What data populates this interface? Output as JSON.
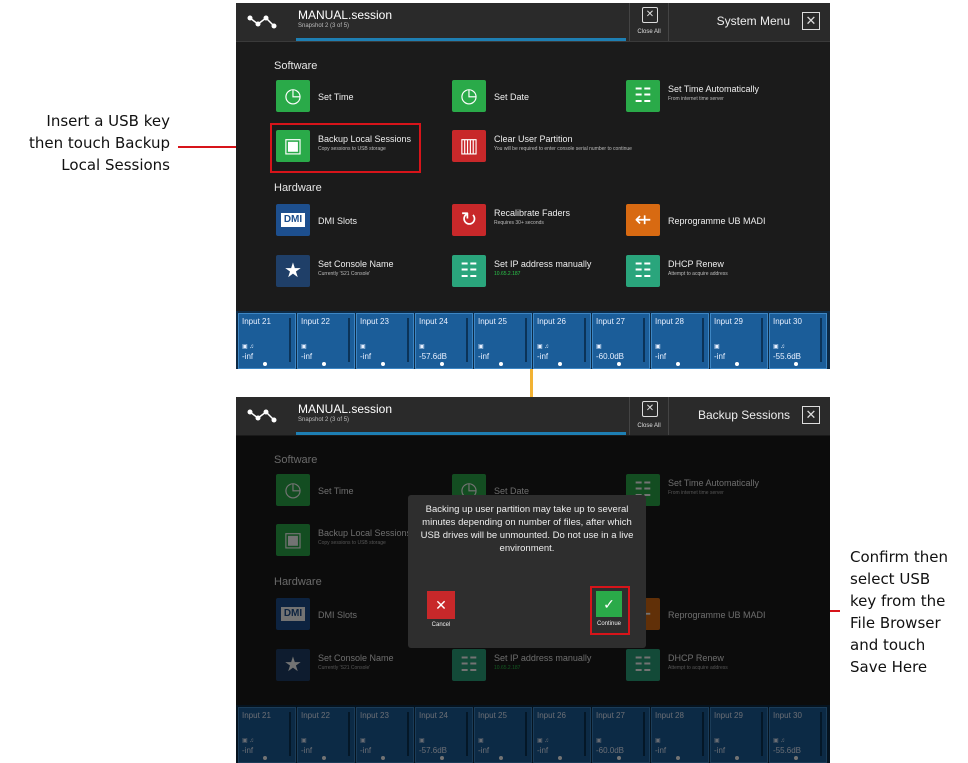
{
  "callout_left": {
    "lines": [
      "Insert a USB key",
      "then touch Backup",
      "Local Sessions"
    ]
  },
  "callout_right": {
    "lines": [
      "Confirm then",
      "select USB",
      "key from the",
      "File Browser",
      "and touch",
      "Save Here"
    ]
  },
  "header": {
    "session": "MANUAL.session",
    "snapshot": "Snapshot 2 (3 of 5)",
    "close_all": "Close All"
  },
  "screen1": {
    "title": "System Menu"
  },
  "screen2": {
    "title": "Backup Sessions"
  },
  "sections": {
    "software": "Software",
    "hardware": "Hardware"
  },
  "items": {
    "set_time": {
      "title": "Set Time"
    },
    "set_date": {
      "title": "Set Date"
    },
    "set_time_auto": {
      "title": "Set Time Automatically",
      "sub": "From internet time server"
    },
    "backup": {
      "title": "Backup Local Sessions",
      "sub": "Copy sessions to USB storage"
    },
    "clear": {
      "title": "Clear User Partition",
      "sub": "You will be required to enter console serial number to continue"
    },
    "dmi": {
      "title": "DMI Slots",
      "icon_text": "DMI"
    },
    "recal": {
      "title": "Recalibrate Faders",
      "sub": "Requires 30+ seconds"
    },
    "reprog": {
      "title": "Reprogramme UB MADI"
    },
    "console_name": {
      "title": "Set Console Name",
      "sub": "Currently 'S21 Console'"
    },
    "set_ip": {
      "title": "Set IP address manually",
      "sub": "10.65.2.187"
    },
    "dhcp": {
      "title": "DHCP Renew",
      "sub": "Attempt to acquire address"
    }
  },
  "channels": [
    {
      "name": "Input 21",
      "value": "-inf"
    },
    {
      "name": "Input 22",
      "value": "-inf"
    },
    {
      "name": "Input 23",
      "value": "-inf"
    },
    {
      "name": "Input 24",
      "value": "-57.6dB"
    },
    {
      "name": "Input 25",
      "value": "-inf"
    },
    {
      "name": "Input 26",
      "value": "-inf"
    },
    {
      "name": "Input 27",
      "value": "-60.0dB"
    },
    {
      "name": "Input 28",
      "value": "-inf"
    },
    {
      "name": "Input 29",
      "value": "-inf"
    },
    {
      "name": "Input 30",
      "value": "-55.6dB"
    }
  ],
  "dialog": {
    "text": "Backing up user partition may take up to several minutes depending on number of files, after which USB drives will be unmounted. Do not use in a live environment.",
    "cancel": "Cancel",
    "continue": "Continue",
    "cancel_icon": "✕",
    "continue_icon": "✓"
  },
  "colors": {
    "accent_red": "#d7141a",
    "arrow": "#f2b233",
    "channel_blue": "#1b5d99",
    "green": "#2aaa49"
  }
}
